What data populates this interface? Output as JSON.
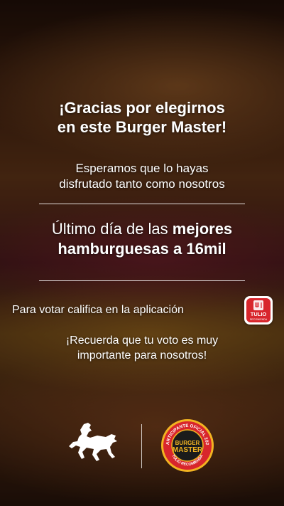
{
  "title": "¡Gracias por elegirnos\nen este Burger Master!",
  "subtitle": "Esperamos que lo hayas\ndisfrutado tanto como nosotros",
  "promo": {
    "line1_regular": "Último día de las ",
    "line1_bold": "mejores",
    "line2_bold": "hamburguesas a 16mil"
  },
  "vote": {
    "text": "Para votar califica en la aplicación",
    "app_icon": "tulio-recomienda-app-icon",
    "app_icon_text": "TULIO",
    "app_icon_subtext": "RECOMIENDA"
  },
  "reminder": "¡Recuerda que tu voto es muy\nimportante para nosotros!",
  "footer": {
    "brand_logo": "horse-rider-logo",
    "badge": {
      "icon": "burger-master-badge",
      "top_text": "PARTICIPANTE OFICIAL 2023",
      "main_text": "BURGER",
      "main_text2": "MASTER",
      "bottom_text": "TULIO RECOMIENDA"
    }
  },
  "colors": {
    "accent_red": "#d8262c",
    "badge_gold": "#f2b321",
    "text": "#ffffff"
  }
}
